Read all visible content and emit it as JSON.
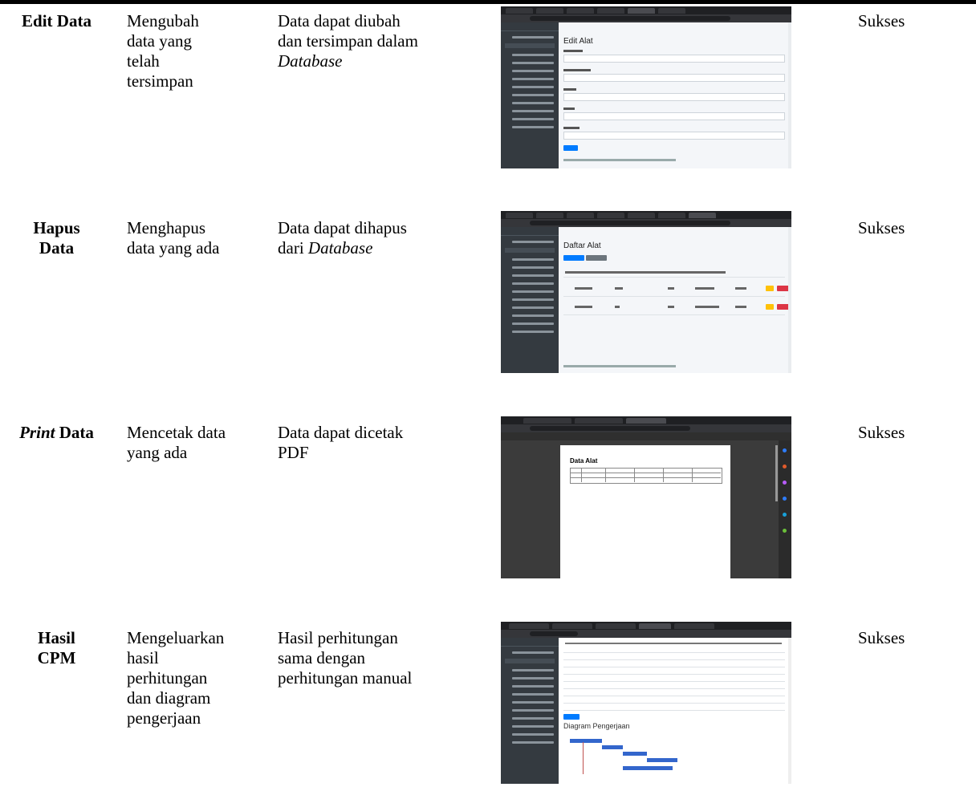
{
  "rows": [
    {
      "feature": "Edit Data",
      "desc_lines": [
        "Mengubah",
        "data yang",
        "telah",
        "tersimpan"
      ],
      "result_plain": "Data dapat diubah",
      "result_line2": "dan tersimpan dalam",
      "result_italic": "Database",
      "status": "Sukses",
      "screenshot": {
        "page_title": "Edit Alat"
      }
    },
    {
      "feature_lines": [
        "Hapus",
        "Data"
      ],
      "desc_lines": [
        "Menghapus",
        "data yang ada"
      ],
      "result_plain": "Data dapat dihapus",
      "result_prefix": "dari ",
      "result_italic": "Database",
      "status": "Sukses",
      "screenshot": {
        "page_title": "Daftar Alat"
      }
    },
    {
      "feature_italic": "Print",
      "feature_rest": " Data",
      "desc_lines": [
        "Mencetak data",
        "yang ada"
      ],
      "result_lines": [
        "Data dapat dicetak",
        "PDF"
      ],
      "status": "Sukses",
      "screenshot": {
        "page_title": "Data Alat"
      }
    },
    {
      "feature_lines": [
        "Hasil",
        "CPM"
      ],
      "desc_lines": [
        "Mengeluarkan",
        "hasil",
        "perhitungan",
        "dan diagram",
        "pengerjaan"
      ],
      "result_lines": [
        "Hasil perhitungan",
        "sama dengan",
        "perhitungan manual"
      ],
      "status": "Sukses",
      "screenshot": {
        "page_title": "Diagram Pengerjaan"
      }
    }
  ],
  "colors": {
    "sidebar": "#343a40",
    "primary": "#007bff",
    "warning": "#ffc107",
    "danger": "#dc3545",
    "gantt": "#3366cc"
  }
}
